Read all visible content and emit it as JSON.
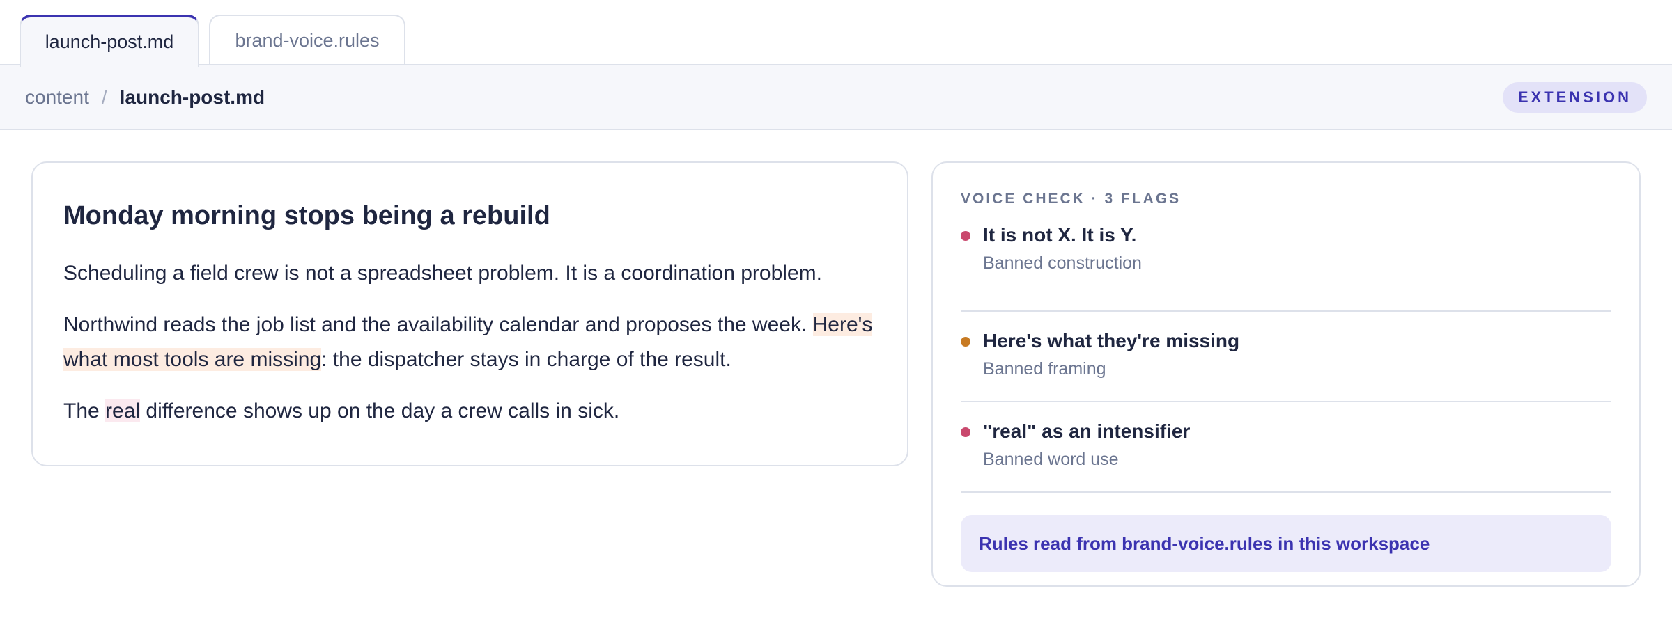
{
  "tabs": [
    {
      "label": "launch-post.md",
      "active": true
    },
    {
      "label": "brand-voice.rules",
      "active": false
    }
  ],
  "breadcrumb": {
    "root": "content",
    "separator": "/",
    "current": "launch-post.md"
  },
  "badge": "EXTENSION",
  "document": {
    "title": "Monday morning stops being a rebuild",
    "p1": "Scheduling a field crew is not a spreadsheet problem. It is a coordination problem.",
    "p2_before": "Northwind reads the job list and the availability calendar and proposes the week. ",
    "p2_highlight": "Here's what most tools are missing",
    "p2_after": ": the dispatcher stays in charge of the result.",
    "p3_before": "The ",
    "p3_highlight": "real",
    "p3_after": " difference shows up on the day a crew calls in sick."
  },
  "voice_check": {
    "heading": "VOICE CHECK · 3 FLAGS",
    "flags": [
      {
        "title": "It is not X. It is Y.",
        "category": "Banned construction",
        "color": "#c9486d"
      },
      {
        "title": "Here's what they're missing",
        "category": "Banned framing",
        "color": "#c77a22"
      },
      {
        "title": "\"real\" as an intensifier",
        "category": "Banned word use",
        "color": "#c9486d"
      }
    ],
    "note": "Rules read from brand-voice.rules in this workspace"
  },
  "colors": {
    "accent": "#3b33b0",
    "highlight_orange": "#fdece1",
    "highlight_pink": "#fbe9ef",
    "border": "#dde1ea"
  }
}
